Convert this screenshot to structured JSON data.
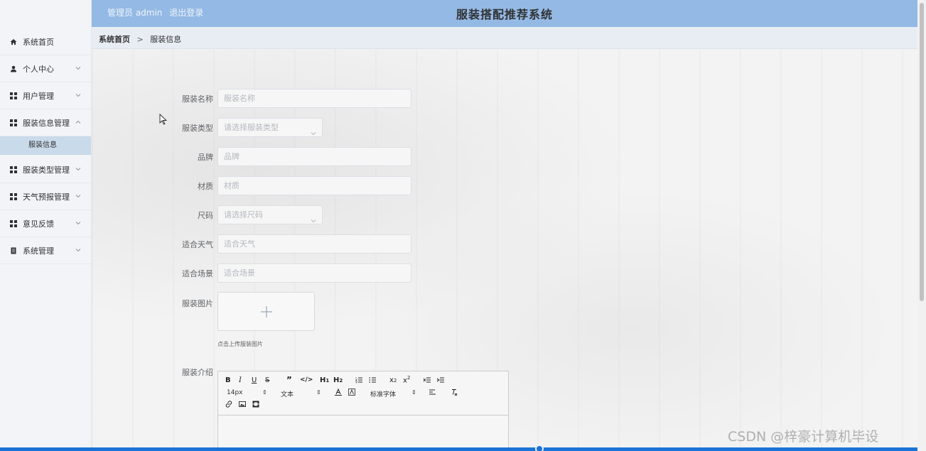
{
  "header": {
    "admin_text": "管理员 admin",
    "logout_text": "退出登录",
    "app_title": "服装搭配推荐系统"
  },
  "sidebar": {
    "items": [
      {
        "label": "系统首页",
        "icon": "home-icon"
      },
      {
        "label": "个人中心",
        "icon": "user-icon",
        "expandable": true
      },
      {
        "label": "用户管理",
        "icon": "grid-icon",
        "expandable": true
      },
      {
        "label": "服装信息管理",
        "icon": "grid-icon",
        "expandable": true,
        "expanded": true
      },
      {
        "label": "服装类型管理",
        "icon": "grid-icon",
        "expandable": true
      },
      {
        "label": "天气预报管理",
        "icon": "grid-icon",
        "expandable": true
      },
      {
        "label": "意见反馈",
        "icon": "grid-icon",
        "expandable": true
      },
      {
        "label": "系统管理",
        "icon": "document-icon",
        "expandable": true
      }
    ],
    "sub_item": "服装信息"
  },
  "breadcrumb": {
    "home": "系统首页",
    "separator": ">",
    "current": "服装信息"
  },
  "form": {
    "name": {
      "label": "服装名称",
      "placeholder": "服装名称"
    },
    "type": {
      "label": "服装类型",
      "placeholder": "请选择服装类型"
    },
    "brand": {
      "label": "品牌",
      "placeholder": "品牌"
    },
    "material": {
      "label": "材质",
      "placeholder": "材质"
    },
    "size": {
      "label": "尺码",
      "placeholder": "请选择尺码"
    },
    "weather": {
      "label": "适合天气",
      "placeholder": "适合天气"
    },
    "scene": {
      "label": "适合场景",
      "placeholder": "适合场景"
    },
    "image": {
      "label": "服装图片",
      "tip": "点击上传服装图片"
    },
    "intro": {
      "label": "服装介绍"
    }
  },
  "editor": {
    "font_size": "14px",
    "text_style": "文本",
    "font_family": "标准字体",
    "buttons": [
      "B",
      "I",
      "U",
      "S",
      "quote",
      "code",
      "H1",
      "H2",
      "ordered-list",
      "bullet-list",
      "subscript",
      "superscript",
      "indent-decrease",
      "indent-increase",
      "text-color",
      "background-color",
      "align",
      "clear-format",
      "link",
      "image",
      "video"
    ]
  },
  "watermark": "CSDN @梓豪计算机毕设",
  "colors": {
    "header_bg": "#94b9e4",
    "submenu_active": "#c9daea",
    "scrollbar": "#1a73d6"
  }
}
